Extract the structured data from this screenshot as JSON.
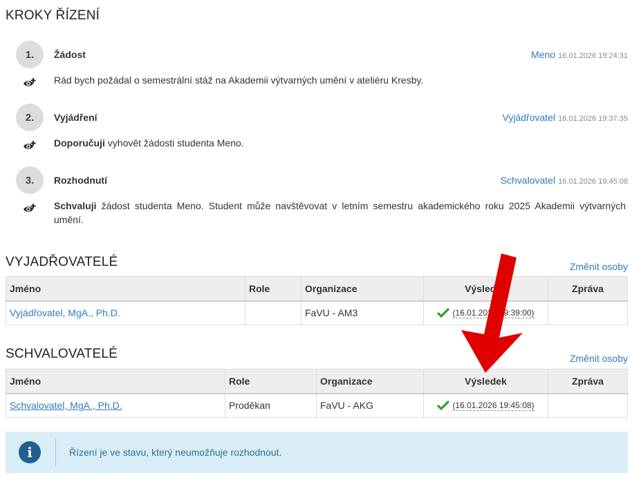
{
  "steps_section": {
    "title": "KROKY ŘÍZENÍ"
  },
  "steps": [
    {
      "number": "1.",
      "name": "Žádost",
      "actor": "Meno",
      "timestamp": "16.01.2026 19:24:31",
      "text_bold": "",
      "text": "Rád bych požádal o semestrální stáž na Akademii výtvarných umění v ateliéru Kresby."
    },
    {
      "number": "2.",
      "name": "Vyjádření",
      "actor": "Vyjádřovatel",
      "timestamp": "16.01.2026 19:37:35",
      "text_bold": "Doporučuji",
      "text": " vyhovět žádosti studenta Meno."
    },
    {
      "number": "3.",
      "name": "Rozhodnutí",
      "actor": "Schvalovatel",
      "timestamp": "16.01.2026 19:45:08",
      "text_bold": "Schvaluji",
      "text": " žádost studenta Meno. Student může navštěvovat v letním semestru akademického roku 2025 Akademii výtvarných umění."
    }
  ],
  "reviewers": {
    "title": "VYJADŘOVATELÉ",
    "change_link": "Změnit osoby",
    "columns": [
      "Jméno",
      "Role",
      "Organizace",
      "Výsledek",
      "Zpráva"
    ],
    "rows": [
      {
        "name": "Vyjádřovatel, MgA., Ph.D.",
        "role": "",
        "organization": "FaVU - AM3",
        "result": "(16.01.2026 19:39:00)",
        "message": ""
      }
    ]
  },
  "approvers": {
    "title": "SCHVALOVATELÉ",
    "change_link": "Změnit osoby",
    "columns": [
      "Jméno",
      "Role",
      "Organizace",
      "Výsledek",
      "Zpráva"
    ],
    "rows": [
      {
        "name": "Schvalovatel, MgA., Ph.D.",
        "role": "Proděkan",
        "organization": "FaVU - AKG",
        "result": "(16.01.2026 19:45:08)",
        "message": ""
      }
    ]
  },
  "alert": {
    "icon": "info-icon",
    "message": "Řízení je ve stavu, který neumožňuje rozhodnout."
  },
  "colors": {
    "link": "#2f7ab8",
    "check": "#2ea02e",
    "arrow": "#e00000",
    "alert_bg": "#d9edf7"
  }
}
